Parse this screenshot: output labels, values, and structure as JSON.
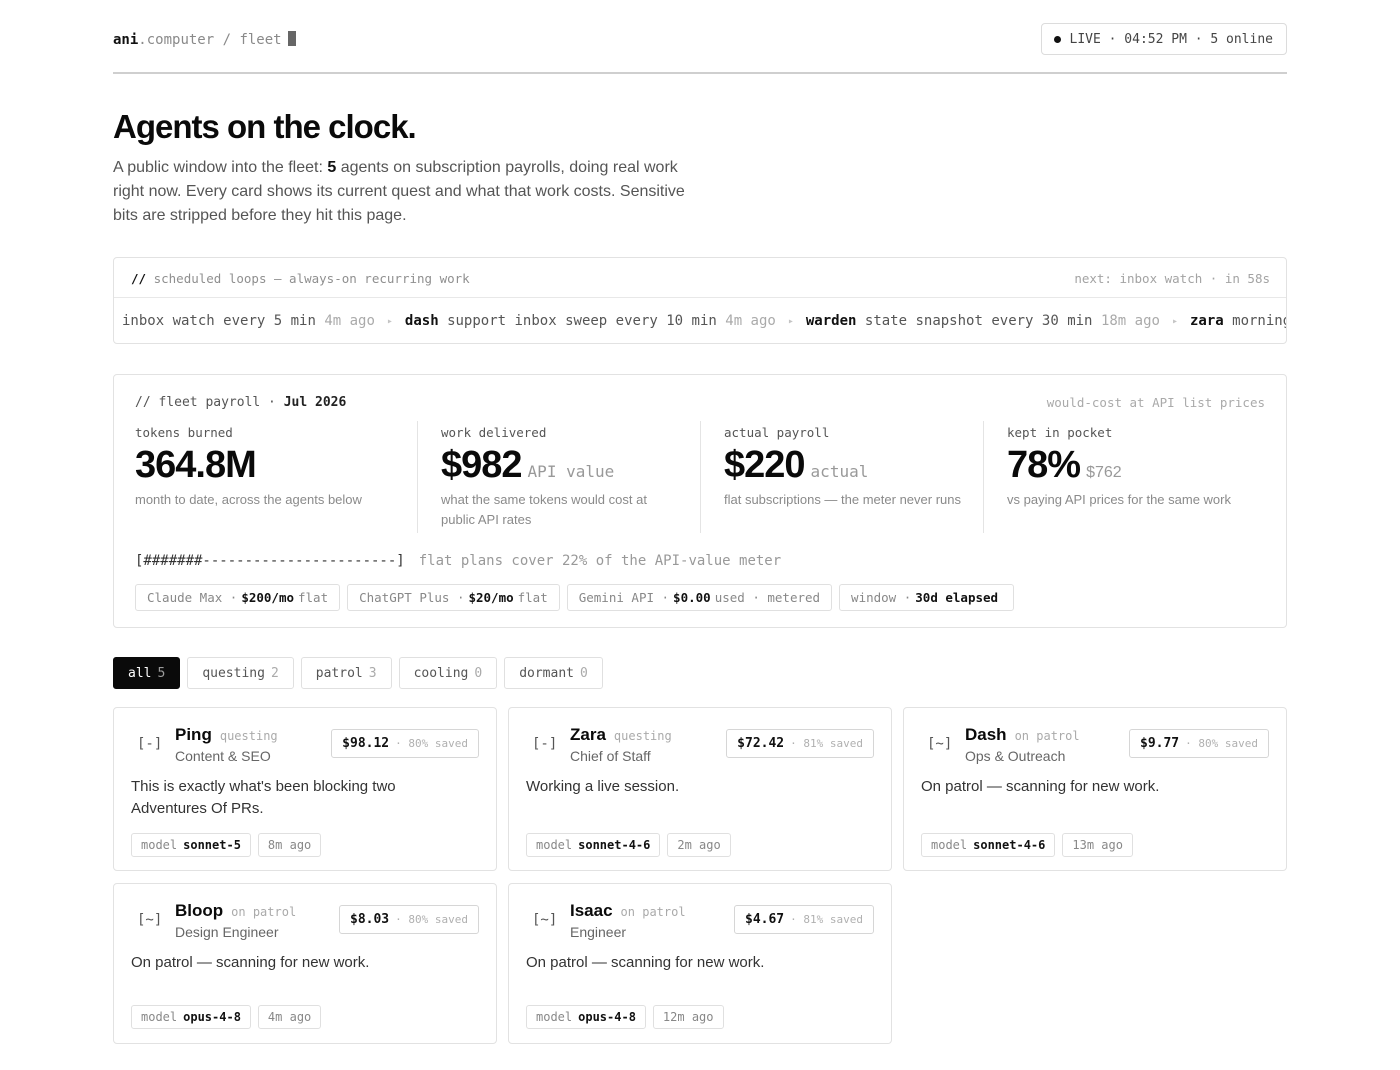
{
  "header": {
    "brand": "ani",
    "brand_suffix": ".computer / fleet",
    "live_status": "LIVE · 04:52 PM · 5 online"
  },
  "hero": {
    "title": "Agents on the clock.",
    "lede_before": "A public window into the fleet: ",
    "agent_count": "5",
    "lede_after": " agents on subscription payrolls, doing real work right now. Every card shows its current quest and what that work costs. Sensitive bits are stripped before they hit this page."
  },
  "loops": {
    "heading_prefix": "//",
    "heading": "scheduled loops — always-on recurring work",
    "next": "next: inbox watch · in 58s",
    "items": [
      {
        "agent": "",
        "task": "inbox watch",
        "every": "every 5 min",
        "ago": "4m ago"
      },
      {
        "agent": "dash",
        "task": "support inbox sweep",
        "every": "every 10 min",
        "ago": "4m ago"
      },
      {
        "agent": "warden",
        "task": "state snapshot",
        "every": "every 30 min",
        "ago": "18m ago"
      },
      {
        "agent": "zara",
        "task": "morning",
        "every": "",
        "ago": ""
      }
    ]
  },
  "payroll": {
    "title_prefix": "// fleet payroll ·",
    "period": "Jul 2026",
    "note": "would-cost at API list prices",
    "stats": [
      {
        "label": "tokens burned",
        "value": "364.8M",
        "unit": "",
        "sub": "month to date, across the agents below"
      },
      {
        "label": "work delivered",
        "value": "$982",
        "unit": "API value",
        "sub": "what the same tokens would cost at public API rates"
      },
      {
        "label": "actual payroll",
        "value": "$220",
        "unit": "actual",
        "sub": "flat subscriptions — the meter never runs"
      },
      {
        "label": "kept in pocket",
        "value": "78%",
        "unit": "$762",
        "sub": "vs paying API prices for the same work"
      }
    ],
    "meter_bar": "[#######-----------------------]",
    "meter_note": "flat plans cover 22% of the API-value meter",
    "coverage": 0.22,
    "plans": [
      {
        "name": "Claude Max ·",
        "amount": "$200/mo",
        "suffix": "flat"
      },
      {
        "name": "ChatGPT Plus ·",
        "amount": "$20/mo",
        "suffix": "flat"
      },
      {
        "name": "Gemini API ·",
        "amount": "$0.00",
        "suffix": "used · metered"
      },
      {
        "name": "window ·",
        "amount": "30d elapsed",
        "suffix": ""
      }
    ]
  },
  "filters": [
    {
      "label": "all",
      "count": "5",
      "active": true
    },
    {
      "label": "questing",
      "count": "2",
      "active": false
    },
    {
      "label": "patrol",
      "count": "3",
      "active": false
    },
    {
      "label": "cooling",
      "count": "0",
      "active": false
    },
    {
      "label": "dormant",
      "count": "0",
      "active": false
    }
  ],
  "agents": [
    {
      "glyph": "[-]",
      "name": "Ping",
      "status": "questing",
      "role": "Content & SEO",
      "cost": "$98.12",
      "saved": "· 80% saved",
      "quest": "This is exactly what's been blocking two Adventures Of PRs.",
      "model_label": "model",
      "model": "sonnet-5",
      "ago": "8m ago"
    },
    {
      "glyph": "[-]",
      "name": "Zara",
      "status": "questing",
      "role": "Chief of Staff",
      "cost": "$72.42",
      "saved": "· 81% saved",
      "quest": "Working a live session.",
      "model_label": "model",
      "model": "sonnet-4-6",
      "ago": "2m ago"
    },
    {
      "glyph": "[~]",
      "name": "Dash",
      "status": "on patrol",
      "role": "Ops & Outreach",
      "cost": "$9.77",
      "saved": "· 80% saved",
      "quest": "On patrol — scanning for new work.",
      "model_label": "model",
      "model": "sonnet-4-6",
      "ago": "13m ago"
    },
    {
      "glyph": "[~]",
      "name": "Bloop",
      "status": "on patrol",
      "role": "Design Engineer",
      "cost": "$8.03",
      "saved": "· 80% saved",
      "quest": "On patrol — scanning for new work.",
      "model_label": "model",
      "model": "opus-4-8",
      "ago": "4m ago"
    },
    {
      "glyph": "[~]",
      "name": "Isaac",
      "status": "on patrol",
      "role": "Engineer",
      "cost": "$4.67",
      "saved": "· 81% saved",
      "quest": "On patrol — scanning for new work.",
      "model_label": "model",
      "model": "opus-4-8",
      "ago": "12m ago"
    }
  ]
}
